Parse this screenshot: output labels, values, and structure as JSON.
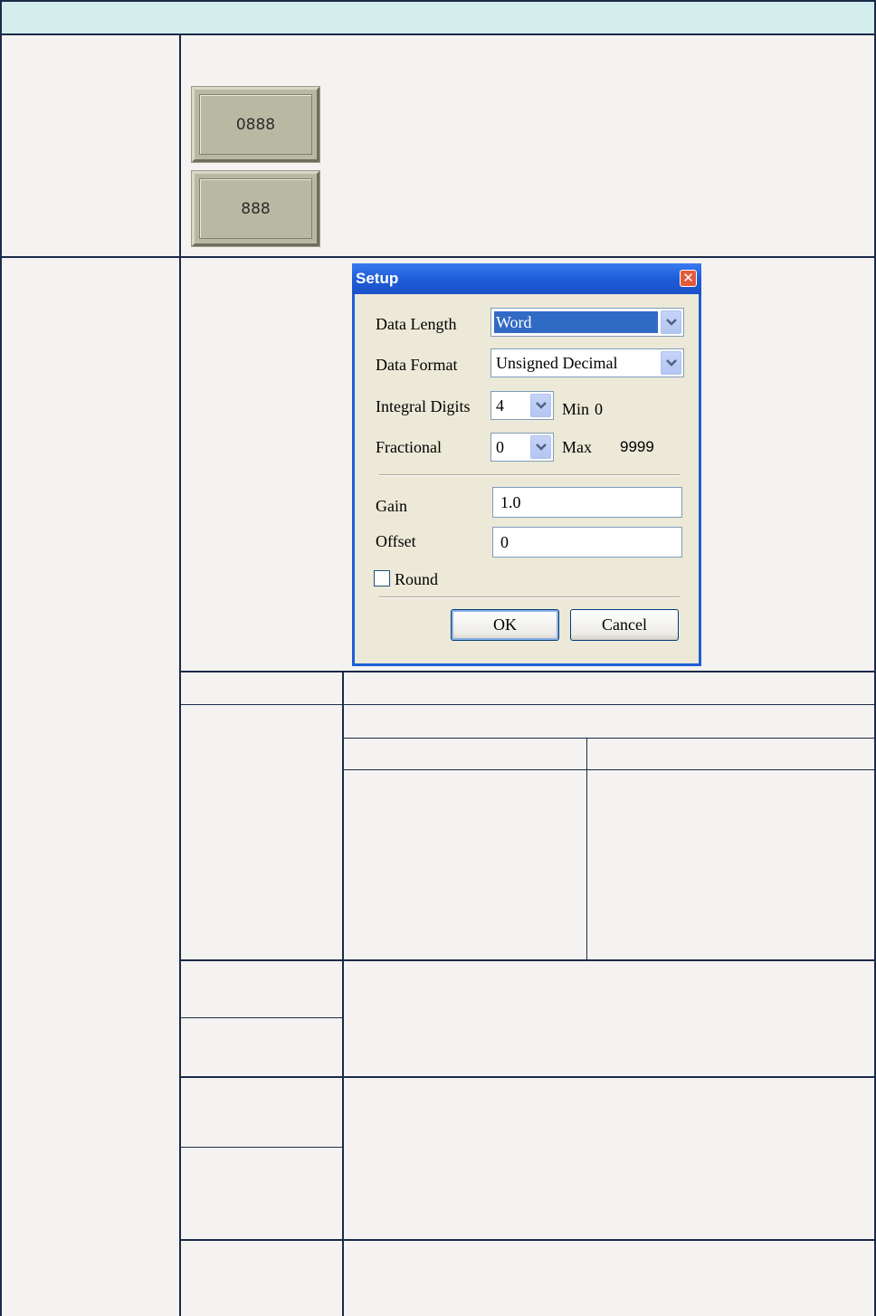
{
  "preview_buttons": [
    "0888",
    "888"
  ],
  "dialog": {
    "title": "Setup",
    "close_glyph": "✕",
    "data_length": {
      "label": "Data Length",
      "value": "Word"
    },
    "data_format": {
      "label": "Data Format",
      "value": "Unsigned Decimal"
    },
    "integral_digits": {
      "label": "Integral Digits",
      "value": "4",
      "min_label": "Min",
      "min_value": "0"
    },
    "fractional": {
      "label": "Fractional",
      "value": "0",
      "max_label": "Max",
      "max_value": "9999"
    },
    "gain": {
      "label": "Gain",
      "value": "1.0"
    },
    "offset": {
      "label": "Offset",
      "value": "0"
    },
    "round": {
      "label": "Round",
      "checked": false
    },
    "ok_label": "OK",
    "cancel_label": "Cancel",
    "accent": "#1d5fd6"
  },
  "colors": {
    "header": "#d4eeee",
    "border": "#1c2a4a",
    "background": "#f4f3f1"
  }
}
